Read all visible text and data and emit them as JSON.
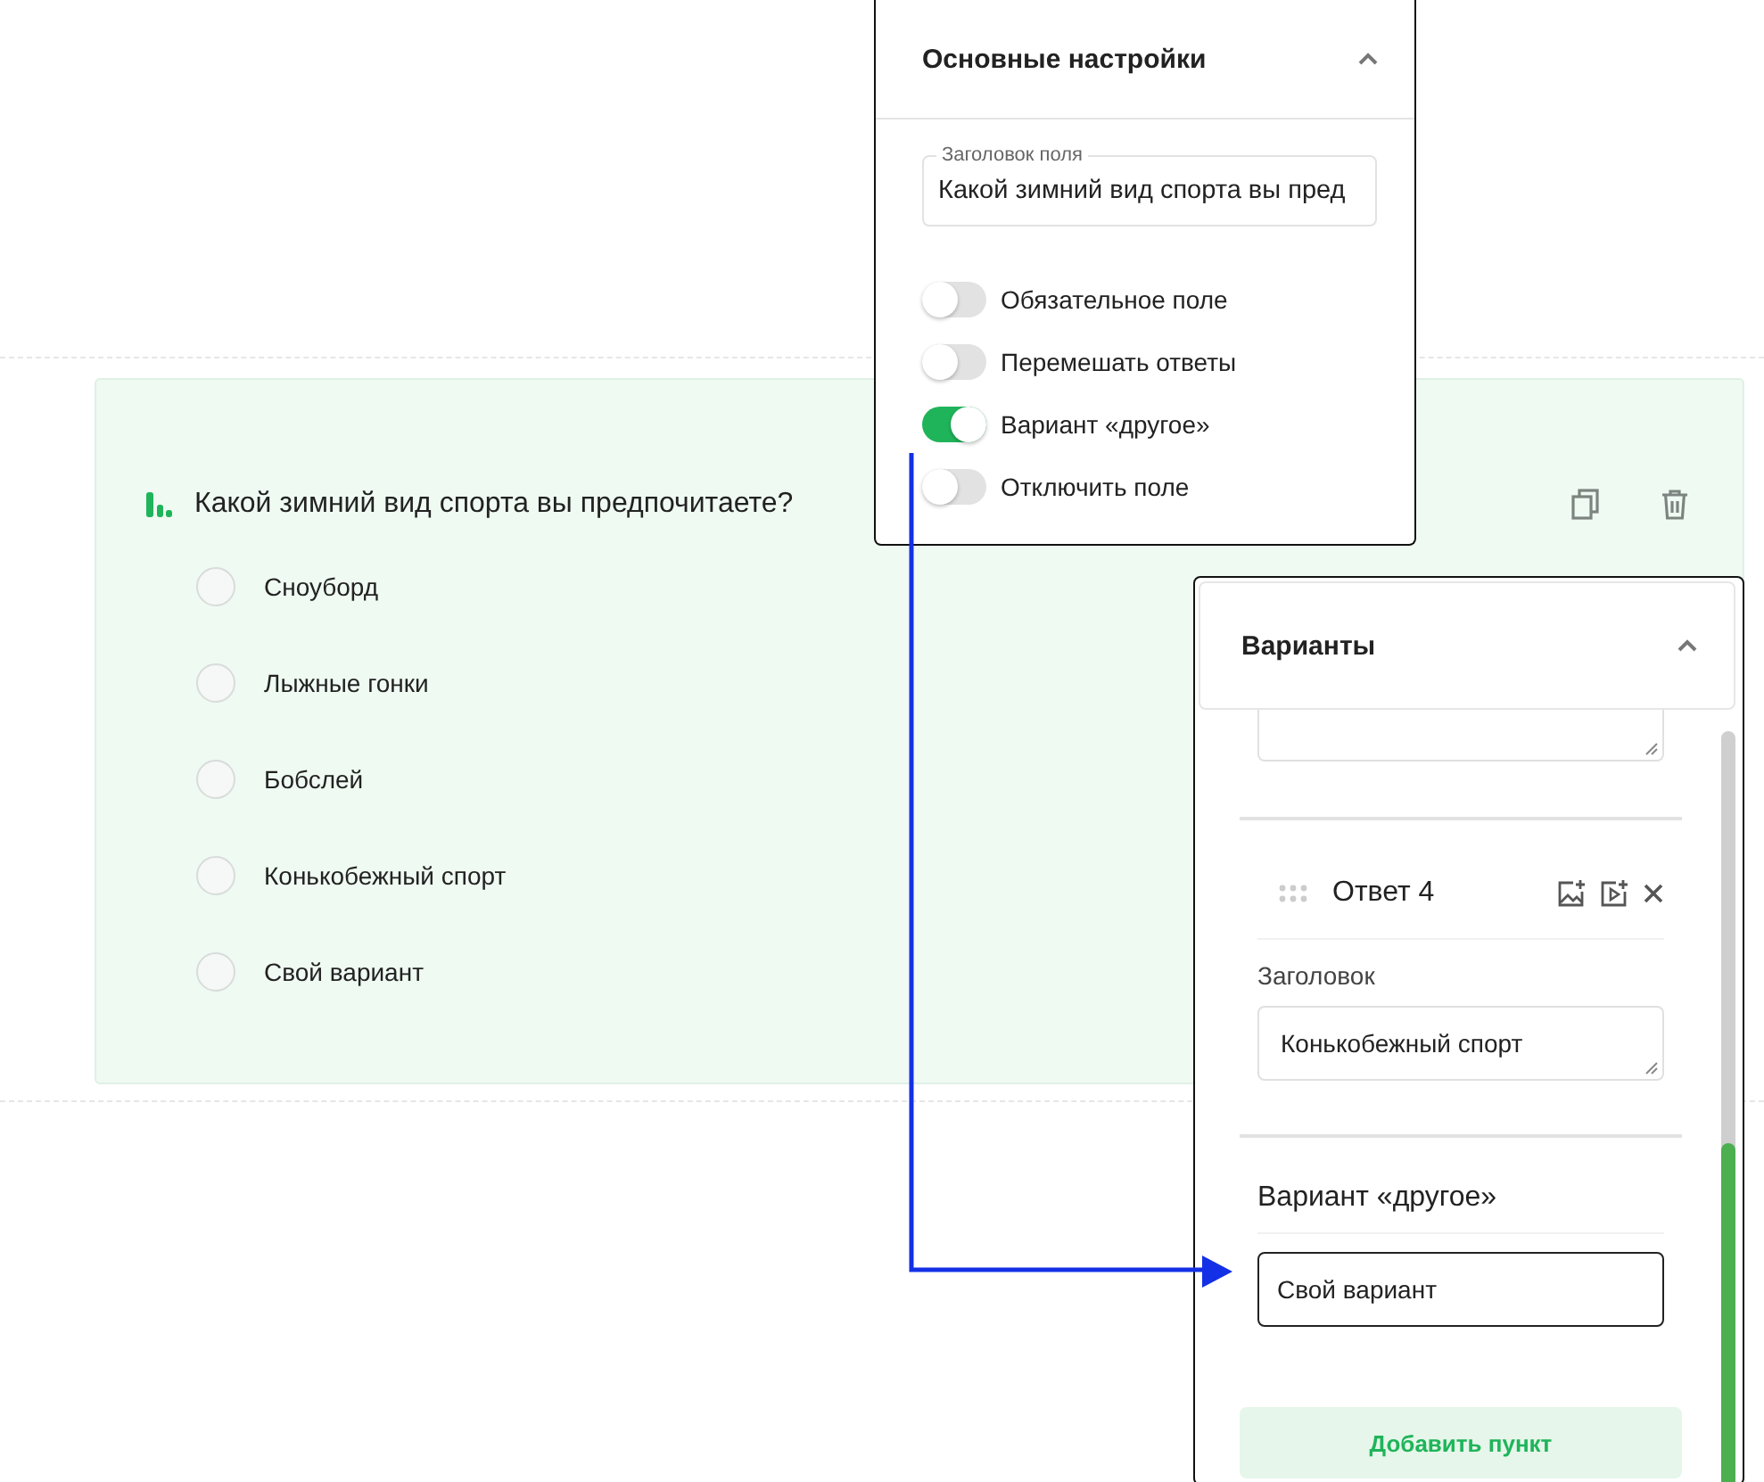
{
  "question": {
    "title": "Какой зимний вид спорта вы предпочитаете?",
    "options": [
      {
        "label": "Сноуборд",
        "selected": false
      },
      {
        "label": "Лыжные гонки",
        "selected": false
      },
      {
        "label": "Бобслей",
        "selected": false
      },
      {
        "label": "Конькобежный спорт",
        "selected": false
      },
      {
        "label": "Свой вариант",
        "selected": false
      }
    ]
  },
  "settings_panel": {
    "title": "Основные настройки",
    "expanded": true,
    "field_title": {
      "label": "Заголовок поля",
      "value": "Какой зимний вид спорта вы пред"
    },
    "toggles": [
      {
        "label": "Обязательное поле",
        "on": false
      },
      {
        "label": "Перемешать ответы",
        "on": false
      },
      {
        "label": "Вариант «другое»",
        "on": true
      },
      {
        "label": "Отключить поле",
        "on": false
      }
    ]
  },
  "variants_panel": {
    "title": "Варианты",
    "expanded": true,
    "answer": {
      "title": "Ответ 4",
      "heading_label": "Заголовок",
      "heading_value": "Конькобежный спорт"
    },
    "other": {
      "title": "Вариант «другое»",
      "value": "Свой вариант"
    },
    "add_button": "Добавить пункт"
  }
}
